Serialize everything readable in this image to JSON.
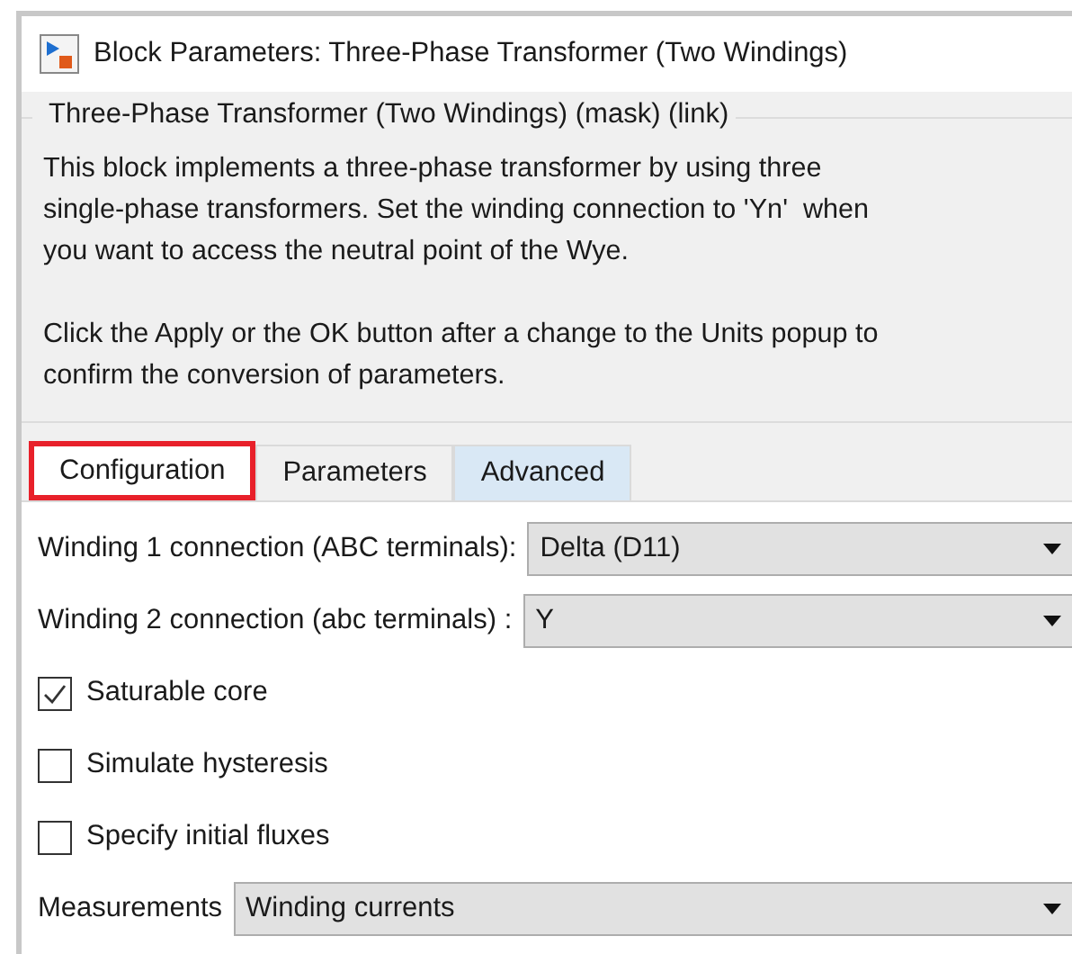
{
  "window": {
    "title": "Block Parameters: Three-Phase Transformer (Two Windings)"
  },
  "group": {
    "title": "Three-Phase Transformer (Two Windings) (mask) (link)",
    "paragraphs": [
      "This block implements a three-phase transformer by using three\nsingle-phase transformers. Set the winding connection to 'Yn'  when\nyou want to access the neutral point of the Wye.",
      "Click the Apply or the OK button after a change to the Units popup to\nconfirm the conversion of parameters."
    ]
  },
  "tabs": [
    {
      "label": "Configuration",
      "selected": true,
      "hovered": false
    },
    {
      "label": "Parameters",
      "selected": false,
      "hovered": false
    },
    {
      "label": "Advanced",
      "selected": false,
      "hovered": true
    }
  ],
  "fields": [
    {
      "kind": "dropdown",
      "label": "Winding 1 connection (ABC terminals):",
      "value": "Delta (D11)"
    },
    {
      "kind": "dropdown",
      "label": "Winding 2 connection (abc terminals) :",
      "value": "Y"
    },
    {
      "kind": "checkbox",
      "label": "Saturable core",
      "checked": true
    },
    {
      "kind": "checkbox",
      "label": "Simulate hysteresis",
      "checked": false
    },
    {
      "kind": "checkbox",
      "label": "Specify initial fluxes",
      "checked": false
    },
    {
      "kind": "dropdown",
      "label": "Measurements",
      "value": "Winding currents"
    }
  ]
}
